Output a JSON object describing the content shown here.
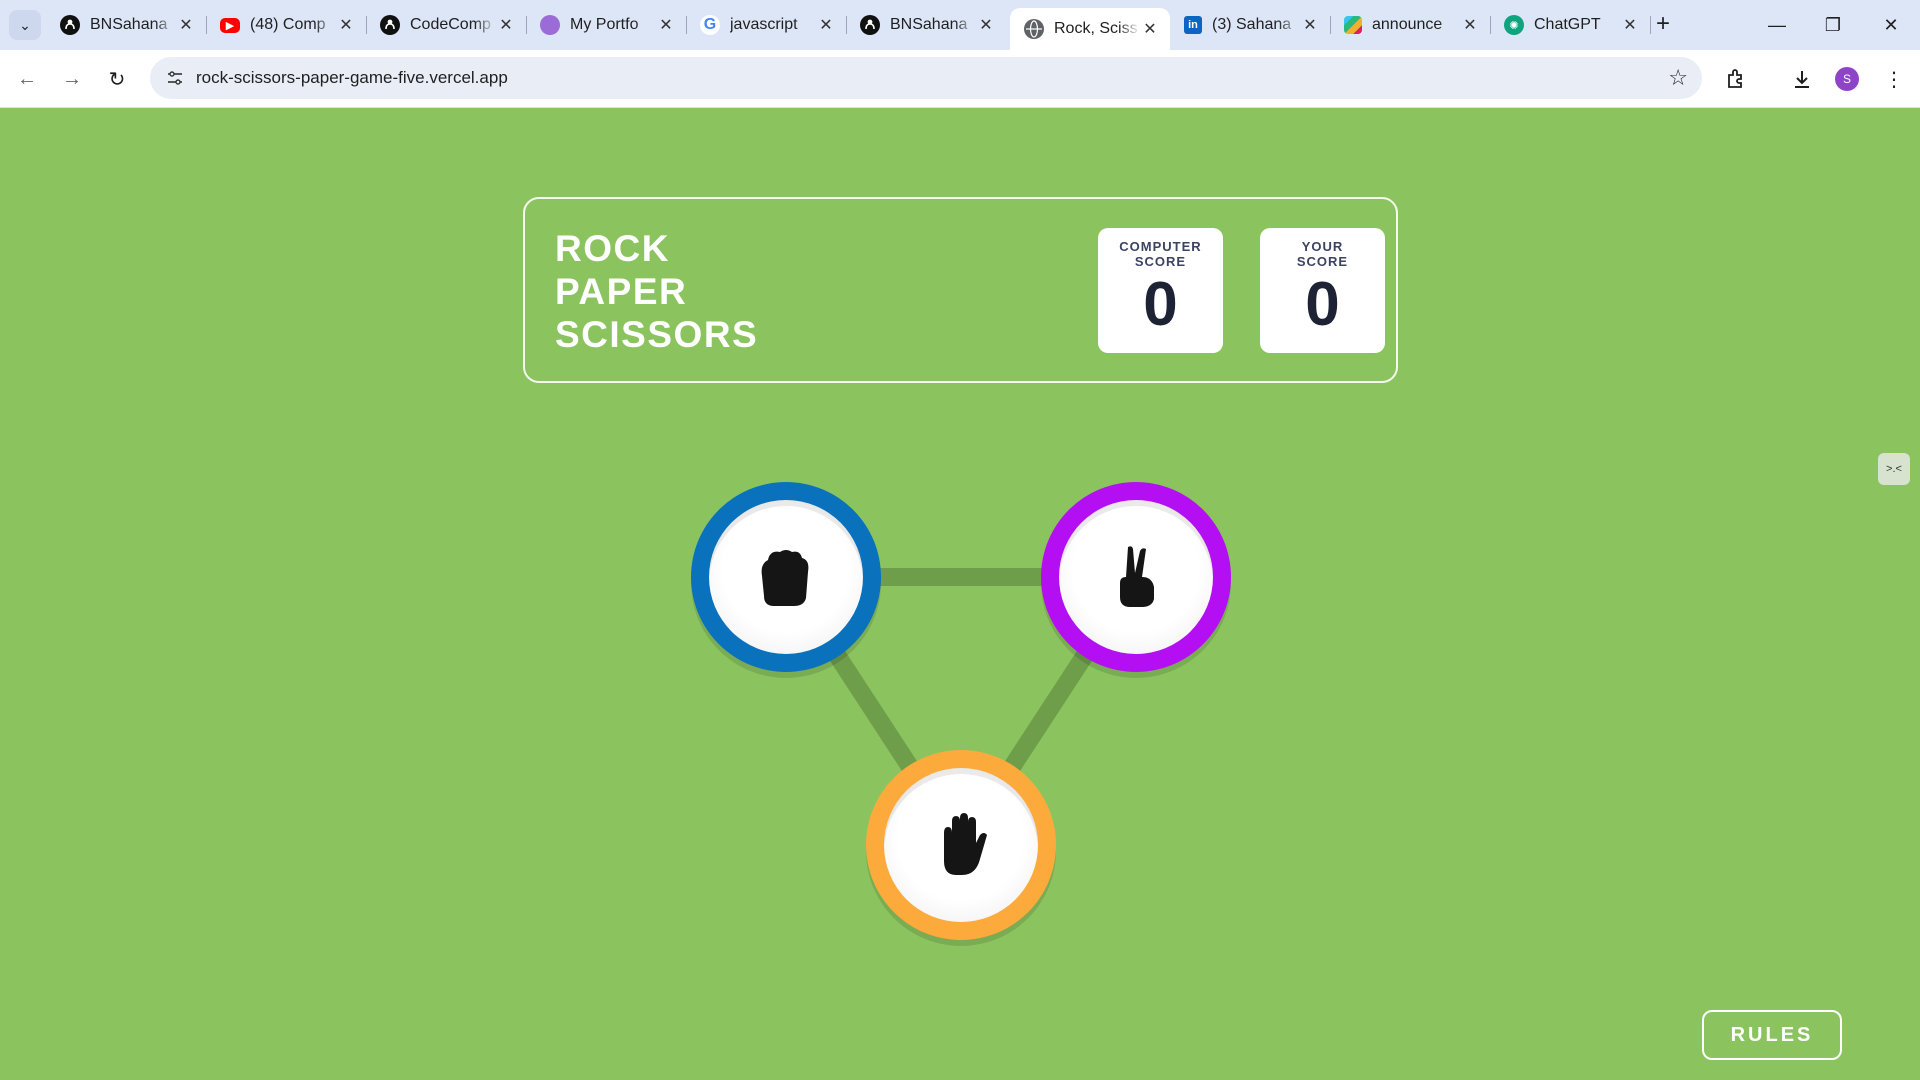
{
  "browser": {
    "tabs": [
      {
        "title": "BNSahana",
        "icon": "github-icon",
        "active": false
      },
      {
        "title": "(48) Comp",
        "icon": "youtube-icon",
        "active": false
      },
      {
        "title": "CodeComp",
        "icon": "github-icon",
        "active": false
      },
      {
        "title": "My Portfo",
        "icon": "portfolio-icon",
        "active": false
      },
      {
        "title": "javascript",
        "icon": "google-icon",
        "active": false
      },
      {
        "title": "BNSahana",
        "icon": "github-icon",
        "active": false
      },
      {
        "title": "Rock, Sciss",
        "icon": "globe-icon",
        "active": true
      },
      {
        "title": "(3) Sahana",
        "icon": "linkedin-icon",
        "active": false
      },
      {
        "title": "announce",
        "icon": "slack-icon",
        "active": false
      },
      {
        "title": "ChatGPT",
        "icon": "chatgpt-icon",
        "active": false
      }
    ],
    "url": "rock-scissors-paper-game-five.vercel.app",
    "profile_initial": "S"
  },
  "game": {
    "title_lines": [
      "ROCK",
      "PAPER",
      "SCISSORS"
    ],
    "computer_score": {
      "label_line1": "COMPUTER",
      "label_line2": "SCORE",
      "value": "0"
    },
    "your_score": {
      "label_line1": "YOUR",
      "label_line2": "SCORE",
      "value": "0"
    },
    "choices": [
      {
        "name": "rock",
        "icon": "fist-icon",
        "ring_color": "#0a72bd"
      },
      {
        "name": "scissors",
        "icon": "peace-hand-icon",
        "ring_color": "#b40ff2"
      },
      {
        "name": "paper",
        "icon": "open-hand-icon",
        "ring_color": "#fcaa3c"
      }
    ],
    "rules_label": "RULES",
    "background_color": "#8bc45f"
  },
  "side_extension_label": ">.<"
}
